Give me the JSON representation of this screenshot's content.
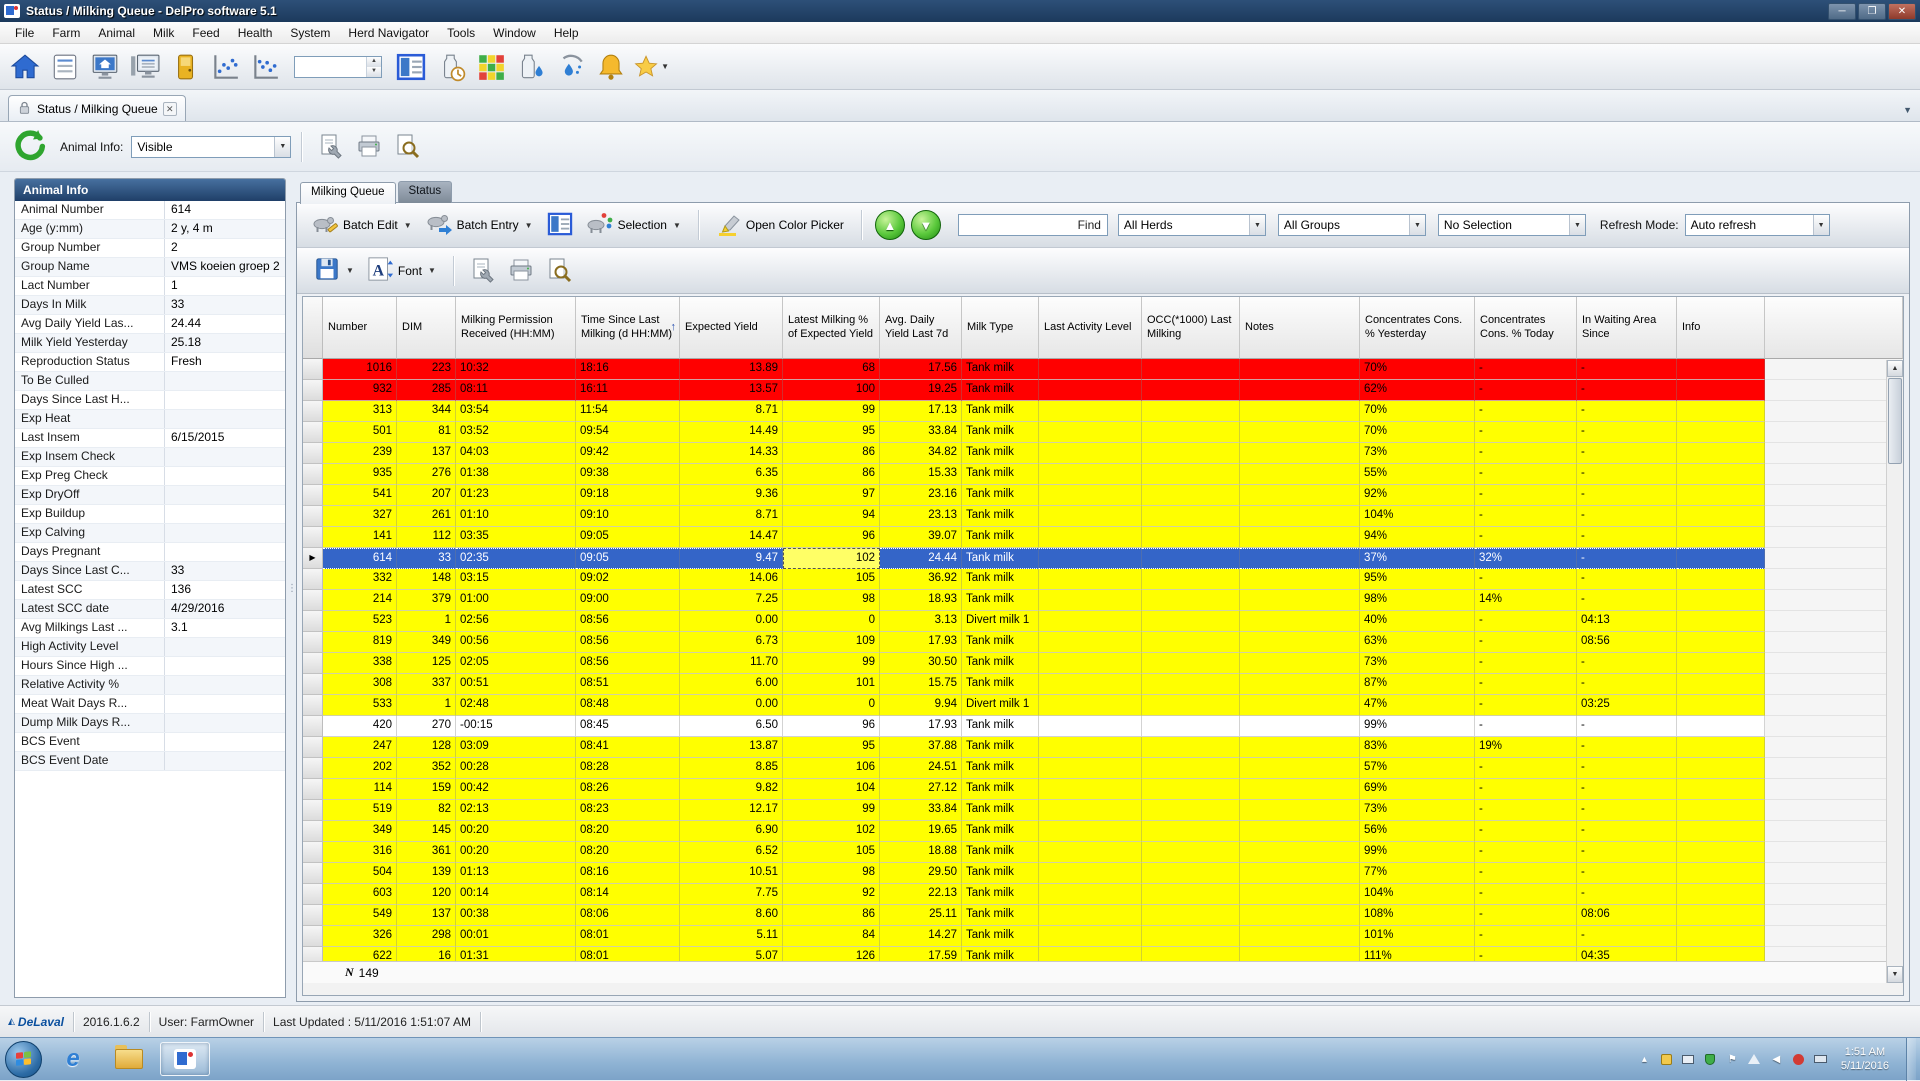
{
  "window": {
    "title": "Status / Milking Queue - DelPro software 5.1"
  },
  "menu": {
    "items": [
      "File",
      "Farm",
      "Animal",
      "Milk",
      "Feed",
      "Health",
      "System",
      "Herd Navigator",
      "Tools",
      "Window",
      "Help"
    ]
  },
  "main_toolbar": {
    "icons": [
      "navigate-home-icon",
      "animal-card-icon",
      "farm-home-icon",
      "farm-monitor-icon",
      "gate-icon",
      "activity-graph-icon",
      "yield-graph-icon",
      "animal-search-spinbox",
      "animal-report-icon",
      "milk-sample-clock-icon",
      "herd-status-grid-icon",
      "milk-drop-icon",
      "milk-splash-icon",
      "alarm-icon",
      "favorites-icon"
    ]
  },
  "tabstrip": {
    "tab_label": "Status / Milking Queue"
  },
  "page_bar": {
    "animal_info_label": "Animal Info:",
    "visibility_value": "Visible"
  },
  "left_panel": {
    "title": "Animal Info",
    "rows": [
      {
        "label": "Animal Number",
        "value": "614"
      },
      {
        "label": "Age (y:mm)",
        "value": "2 y, 4 m"
      },
      {
        "label": "Group Number",
        "value": "2"
      },
      {
        "label": "Group Name",
        "value": "VMS koeien groep 2"
      },
      {
        "label": "Lact Number",
        "value": "1"
      },
      {
        "label": "Days In Milk",
        "value": "33"
      },
      {
        "label": "Avg Daily Yield Las...",
        "value": "24.44"
      },
      {
        "label": "Milk Yield Yesterday",
        "value": "25.18"
      },
      {
        "label": "Reproduction Status",
        "value": "Fresh"
      },
      {
        "label": "To Be Culled",
        "value": ""
      },
      {
        "label": "Days Since Last H...",
        "value": ""
      },
      {
        "label": "Exp Heat",
        "value": ""
      },
      {
        "label": "Last Insem",
        "value": "6/15/2015"
      },
      {
        "label": "Exp Insem Check",
        "value": ""
      },
      {
        "label": "Exp Preg Check",
        "value": ""
      },
      {
        "label": "Exp DryOff",
        "value": ""
      },
      {
        "label": "Exp Buildup",
        "value": ""
      },
      {
        "label": "Exp Calving",
        "value": ""
      },
      {
        "label": "Days Pregnant",
        "value": ""
      },
      {
        "label": "Days Since Last C...",
        "value": "33"
      },
      {
        "label": "Latest SCC",
        "value": "136"
      },
      {
        "label": "Latest SCC date",
        "value": "4/29/2016"
      },
      {
        "label": "Avg Milkings Last ...",
        "value": "3.1"
      },
      {
        "label": "High Activity Level",
        "value": ""
      },
      {
        "label": "Hours Since High ...",
        "value": ""
      },
      {
        "label": "Relative Activity %",
        "value": ""
      },
      {
        "label": "Meat Wait Days R...",
        "value": ""
      },
      {
        "label": "Dump Milk Days R...",
        "value": ""
      },
      {
        "label": "BCS Event",
        "value": ""
      },
      {
        "label": "BCS Event Date",
        "value": ""
      }
    ]
  },
  "queue": {
    "tabs": [
      "Milking Queue",
      "Status"
    ],
    "toolbar": {
      "batch_edit_label": "Batch Edit",
      "batch_entry_label": "Batch Entry",
      "selection_label": "Selection",
      "color_picker_label": "Open Color Picker",
      "find_label": "Find",
      "herd_filter_value": "All Herds",
      "group_filter_value": "All Groups",
      "selection_filter_value": "No Selection",
      "refresh_mode_label": "Refresh Mode:",
      "refresh_mode_value": "Auto refresh",
      "font_label": "Font"
    }
  },
  "grid": {
    "columns": [
      "Number",
      "DIM",
      "Milking Permission Received (HH:MM)",
      "Time Since Last Milking (d HH:MM)",
      "Expected Yield",
      "Latest Milking % of Expected Yield",
      "Avg. Daily Yield Last 7d",
      "Milk Type",
      "Last Activity Level",
      "OCC(*1000) Last Milking",
      "Notes",
      "Concentrates Cons. % Yesterday",
      "Concentrates Cons. % Today",
      "In Waiting Area Since",
      "Info"
    ],
    "sort_column_index": 3,
    "record_count": "149",
    "rows": [
      {
        "state": "red",
        "cells": [
          "1016",
          "223",
          "10:32",
          "18:16",
          "13.89",
          "68",
          "17.56",
          "Tank milk",
          "",
          "",
          "",
          "70%",
          "-",
          "-",
          ""
        ]
      },
      {
        "state": "red",
        "cells": [
          "932",
          "285",
          "08:11",
          "16:11",
          "13.57",
          "100",
          "19.25",
          "Tank milk",
          "",
          "",
          "",
          "62%",
          "-",
          "-",
          ""
        ]
      },
      {
        "state": "yellow",
        "cells": [
          "313",
          "344",
          "03:54",
          "11:54",
          "8.71",
          "99",
          "17.13",
          "Tank milk",
          "",
          "",
          "",
          "70%",
          "-",
          "-",
          ""
        ]
      },
      {
        "state": "yellow",
        "cells": [
          "501",
          "81",
          "03:52",
          "09:54",
          "14.49",
          "95",
          "33.84",
          "Tank milk",
          "",
          "",
          "",
          "70%",
          "-",
          "-",
          ""
        ]
      },
      {
        "state": "yellow",
        "cells": [
          "239",
          "137",
          "04:03",
          "09:42",
          "14.33",
          "86",
          "34.82",
          "Tank milk",
          "",
          "",
          "",
          "73%",
          "-",
          "-",
          ""
        ]
      },
      {
        "state": "yellow",
        "cells": [
          "935",
          "276",
          "01:38",
          "09:38",
          "6.35",
          "86",
          "15.33",
          "Tank milk",
          "",
          "",
          "",
          "55%",
          "-",
          "-",
          ""
        ]
      },
      {
        "state": "yellow",
        "cells": [
          "541",
          "207",
          "01:23",
          "09:18",
          "9.36",
          "97",
          "23.16",
          "Tank milk",
          "",
          "",
          "",
          "92%",
          "-",
          "-",
          ""
        ]
      },
      {
        "state": "yellow",
        "cells": [
          "327",
          "261",
          "01:10",
          "09:10",
          "8.71",
          "94",
          "23.13",
          "Tank milk",
          "",
          "",
          "",
          "104%",
          "-",
          "-",
          ""
        ]
      },
      {
        "state": "yellow",
        "cells": [
          "141",
          "112",
          "03:35",
          "09:05",
          "14.47",
          "96",
          "39.07",
          "Tank milk",
          "",
          "",
          "",
          "94%",
          "-",
          "-",
          ""
        ]
      },
      {
        "state": "selected",
        "cells": [
          "614",
          "33",
          "02:35",
          "09:05",
          "9.47",
          "102",
          "24.44",
          "Tank milk",
          "",
          "",
          "",
          "37%",
          "32%",
          "-",
          ""
        ]
      },
      {
        "state": "yellow",
        "cells": [
          "332",
          "148",
          "03:15",
          "09:02",
          "14.06",
          "105",
          "36.92",
          "Tank milk",
          "",
          "",
          "",
          "95%",
          "-",
          "-",
          ""
        ]
      },
      {
        "state": "yellow",
        "cells": [
          "214",
          "379",
          "01:00",
          "09:00",
          "7.25",
          "98",
          "18.93",
          "Tank milk",
          "",
          "",
          "",
          "98%",
          "14%",
          "-",
          ""
        ]
      },
      {
        "state": "yellow",
        "cells": [
          "523",
          "1",
          "02:56",
          "08:56",
          "0.00",
          "0",
          "3.13",
          "Divert milk 1",
          "",
          "",
          "",
          "40%",
          "-",
          "04:13",
          ""
        ]
      },
      {
        "state": "yellow",
        "cells": [
          "819",
          "349",
          "00:56",
          "08:56",
          "6.73",
          "109",
          "17.93",
          "Tank milk",
          "",
          "",
          "",
          "63%",
          "-",
          "08:56",
          ""
        ]
      },
      {
        "state": "yellow",
        "cells": [
          "338",
          "125",
          "02:05",
          "08:56",
          "11.70",
          "99",
          "30.50",
          "Tank milk",
          "",
          "",
          "",
          "73%",
          "-",
          "-",
          ""
        ]
      },
      {
        "state": "yellow",
        "cells": [
          "308",
          "337",
          "00:51",
          "08:51",
          "6.00",
          "101",
          "15.75",
          "Tank milk",
          "",
          "",
          "",
          "87%",
          "-",
          "-",
          ""
        ]
      },
      {
        "state": "yellow",
        "cells": [
          "533",
          "1",
          "02:48",
          "08:48",
          "0.00",
          "0",
          "9.94",
          "Divert milk 1",
          "",
          "",
          "",
          "47%",
          "-",
          "03:25",
          ""
        ]
      },
      {
        "state": "white",
        "cells": [
          "420",
          "270",
          "-00:15",
          "08:45",
          "6.50",
          "96",
          "17.93",
          "Tank milk",
          "",
          "",
          "",
          "99%",
          "-",
          "-",
          ""
        ]
      },
      {
        "state": "yellow",
        "cells": [
          "247",
          "128",
          "03:09",
          "08:41",
          "13.87",
          "95",
          "37.88",
          "Tank milk",
          "",
          "",
          "",
          "83%",
          "19%",
          "-",
          ""
        ]
      },
      {
        "state": "yellow",
        "cells": [
          "202",
          "352",
          "00:28",
          "08:28",
          "8.85",
          "106",
          "24.51",
          "Tank milk",
          "",
          "",
          "",
          "57%",
          "-",
          "-",
          ""
        ]
      },
      {
        "state": "yellow",
        "cells": [
          "114",
          "159",
          "00:42",
          "08:26",
          "9.82",
          "104",
          "27.12",
          "Tank milk",
          "",
          "",
          "",
          "69%",
          "-",
          "-",
          ""
        ]
      },
      {
        "state": "yellow",
        "cells": [
          "519",
          "82",
          "02:13",
          "08:23",
          "12.17",
          "99",
          "33.84",
          "Tank milk",
          "",
          "",
          "",
          "73%",
          "-",
          "-",
          ""
        ]
      },
      {
        "state": "yellow",
        "cells": [
          "349",
          "145",
          "00:20",
          "08:20",
          "6.90",
          "102",
          "19.65",
          "Tank milk",
          "",
          "",
          "",
          "56%",
          "-",
          "-",
          ""
        ]
      },
      {
        "state": "yellow",
        "cells": [
          "316",
          "361",
          "00:20",
          "08:20",
          "6.52",
          "105",
          "18.88",
          "Tank milk",
          "",
          "",
          "",
          "99%",
          "-",
          "-",
          ""
        ]
      },
      {
        "state": "yellow",
        "cells": [
          "504",
          "139",
          "01:13",
          "08:16",
          "10.51",
          "98",
          "29.50",
          "Tank milk",
          "",
          "",
          "",
          "77%",
          "-",
          "-",
          ""
        ]
      },
      {
        "state": "yellow",
        "cells": [
          "603",
          "120",
          "00:14",
          "08:14",
          "7.75",
          "92",
          "22.13",
          "Tank milk",
          "",
          "",
          "",
          "104%",
          "-",
          "-",
          ""
        ]
      },
      {
        "state": "yellow",
        "cells": [
          "549",
          "137",
          "00:38",
          "08:06",
          "8.60",
          "86",
          "25.11",
          "Tank milk",
          "",
          "",
          "",
          "108%",
          "-",
          "08:06",
          ""
        ]
      },
      {
        "state": "yellow",
        "cells": [
          "326",
          "298",
          "00:01",
          "08:01",
          "5.11",
          "84",
          "14.27",
          "Tank milk",
          "",
          "",
          "",
          "101%",
          "-",
          "-",
          ""
        ]
      },
      {
        "state": "yellow",
        "cells": [
          "622",
          "16",
          "01:31",
          "08:01",
          "5.07",
          "126",
          "17.59",
          "Tank milk",
          "",
          "",
          "",
          "111%",
          "-",
          "04:35",
          ""
        ]
      }
    ]
  },
  "status_bar": {
    "brand": "DeLaval",
    "version": "2016.1.6.2",
    "user": "User: FarmOwner",
    "last_updated": "Last Updated : 5/11/2016 1:51:07 AM"
  },
  "taskbar": {
    "time": "1:51 AM",
    "date": "5/11/2016"
  }
}
